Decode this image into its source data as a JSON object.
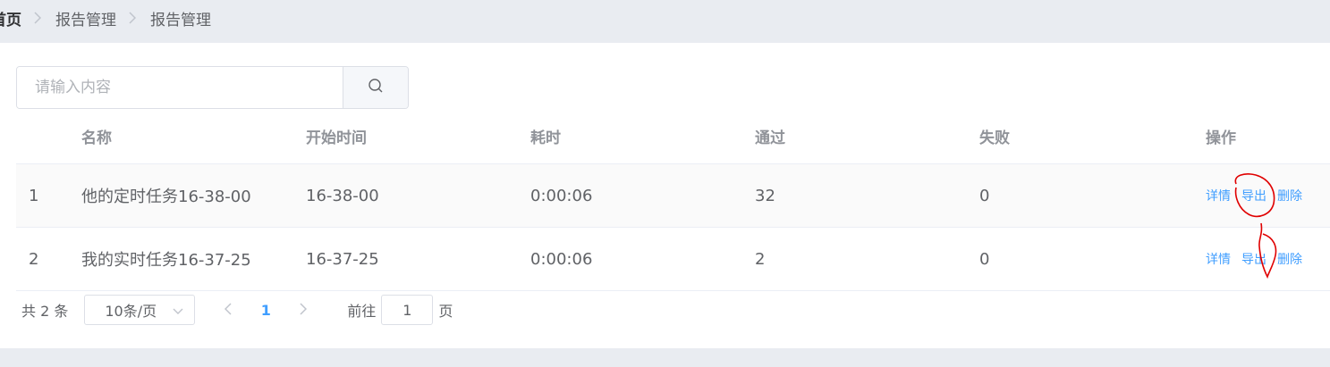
{
  "breadcrumb": {
    "items": [
      "首页",
      "报告管理",
      "报告管理"
    ]
  },
  "search": {
    "placeholder": "请输入内容"
  },
  "table": {
    "headers": [
      "名称",
      "开始时间",
      "耗时",
      "通过",
      "失败",
      "操作"
    ],
    "rows": [
      {
        "index": "1",
        "name": "他的定时任务16-38-00",
        "start": "16-38-00",
        "duration": "0:00:06",
        "pass": "32",
        "fail": "0"
      },
      {
        "index": "2",
        "name": "我的实时任务16-37-25",
        "start": "16-37-25",
        "duration": "0:00:06",
        "pass": "2",
        "fail": "0"
      }
    ],
    "actions": [
      "详情",
      "导出",
      "删除"
    ]
  },
  "pagination": {
    "total_text": "共 2 条",
    "page_size": "10条/页",
    "current_page": "1",
    "goto_label": "前往",
    "goto_value": "1",
    "page_suffix": "页"
  },
  "colors": {
    "accent": "#409eff",
    "annotation": "#e00000"
  }
}
